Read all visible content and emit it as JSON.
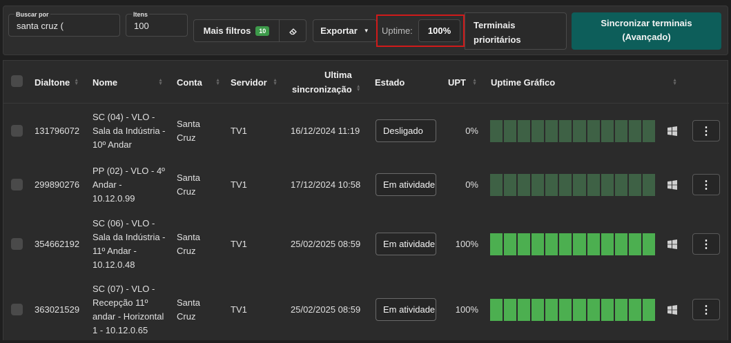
{
  "toolbar": {
    "search_label": "Buscar por",
    "search_value": "santa cruz (",
    "items_label": "Itens",
    "items_value": "100",
    "more_filters": "Mais filtros",
    "filters_count": "10",
    "export": "Exportar",
    "uptime_label": "Uptime:",
    "uptime_value": "100%",
    "priority_line1": "Terminais",
    "priority_line2": "prioritários",
    "sync_line1": "Sincronizar terminais",
    "sync_line2": "(Avançado)"
  },
  "columns": {
    "dialtone": "Dialtone",
    "nome": "Nome",
    "conta": "Conta",
    "servidor": "Servidor",
    "sync_line1": "Ultima",
    "sync_line2": "sincronização",
    "estado": "Estado",
    "upt": "UPT",
    "graph": "Uptime Gráfico"
  },
  "colors": {
    "offline_bar": "#3e6145",
    "online_bar": "#4caf50",
    "sync_button": "#0d5e5a",
    "highlight": "#d11a1a"
  },
  "rows": [
    {
      "dialtone": "131796072",
      "nome": [
        "SC (04) - VLO -",
        "Sala da Indústria -",
        "10º Andar"
      ],
      "conta": [
        "Santa",
        "Cruz"
      ],
      "servidor": "TV1",
      "sync": "16/12/2024 11:19",
      "estado": "Desligado",
      "upt": "0%",
      "graph_state": "offline",
      "os_icon": "windows-icon"
    },
    {
      "dialtone": "299890276",
      "nome": [
        "PP (02) - VLO - 4º",
        "Andar -",
        "10.12.0.99"
      ],
      "conta": [
        "Santa",
        "Cruz"
      ],
      "servidor": "TV1",
      "sync": "17/12/2024 10:58",
      "estado": "Em atividade",
      "upt": "0%",
      "graph_state": "offline",
      "os_icon": "windows-icon"
    },
    {
      "dialtone": "354662192",
      "nome": [
        "SC (06) - VLO -",
        "Sala da Indústria -",
        "11º Andar -",
        "10.12.0.48"
      ],
      "conta": [
        "Santa",
        "Cruz"
      ],
      "servidor": "TV1",
      "sync": "25/02/2025 08:59",
      "estado": "Em atividade",
      "upt": "100%",
      "graph_state": "online",
      "os_icon": "windows-icon"
    },
    {
      "dialtone": "363021529",
      "nome": [
        "SC (07) - VLO -",
        "Recepção 11º",
        "andar - Horizontal",
        "1 - 10.12.0.65"
      ],
      "conta": [
        "Santa",
        "Cruz"
      ],
      "servidor": "TV1",
      "sync": "25/02/2025 08:59",
      "estado": "Em atividade",
      "upt": "100%",
      "graph_state": "online",
      "os_icon": "windows-icon"
    }
  ]
}
